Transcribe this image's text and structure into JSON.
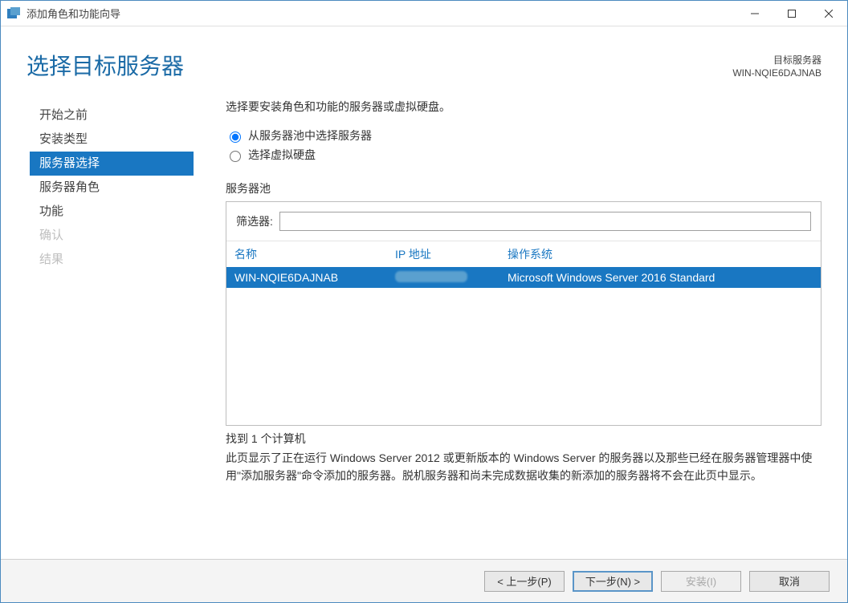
{
  "window": {
    "title": "添加角色和功能向导"
  },
  "header": {
    "page_title": "选择目标服务器",
    "target_label": "目标服务器",
    "target_name": "WIN-NQIE6DAJNAB"
  },
  "nav": {
    "items": [
      {
        "label": "开始之前",
        "state": "enabled"
      },
      {
        "label": "安装类型",
        "state": "enabled"
      },
      {
        "label": "服务器选择",
        "state": "selected"
      },
      {
        "label": "服务器角色",
        "state": "enabled"
      },
      {
        "label": "功能",
        "state": "enabled"
      },
      {
        "label": "确认",
        "state": "disabled"
      },
      {
        "label": "结果",
        "state": "disabled"
      }
    ]
  },
  "main": {
    "instruction": "选择要安装角色和功能的服务器或虚拟硬盘。",
    "radio_pool": "从服务器池中选择服务器",
    "radio_vhd": "选择虚拟硬盘",
    "pool_label": "服务器池",
    "filter_label": "筛选器:",
    "filter_value": "",
    "columns": {
      "name": "名称",
      "ip": "IP 地址",
      "os": "操作系统"
    },
    "rows": [
      {
        "name": "WIN-NQIE6DAJNAB",
        "ip": "",
        "os": "Microsoft Windows Server 2016 Standard",
        "selected": true
      }
    ],
    "found_text": "找到 1 个计算机",
    "explain": "此页显示了正在运行 Windows Server 2012 或更新版本的 Windows Server 的服务器以及那些已经在服务器管理器中使用\"添加服务器\"命令添加的服务器。脱机服务器和尚未完成数据收集的新添加的服务器将不会在此页中显示。"
  },
  "footer": {
    "prev": "< 上一步(P)",
    "next": "下一步(N) >",
    "install": "安装(I)",
    "cancel": "取消"
  }
}
